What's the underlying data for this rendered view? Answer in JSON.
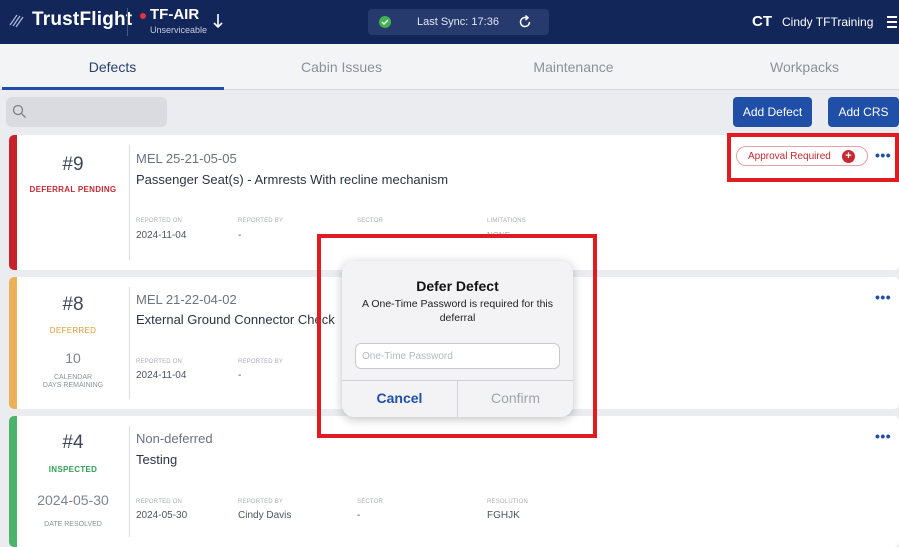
{
  "header": {
    "brand": "TrustFlight",
    "aircraft_reg": "TF-AIR",
    "aircraft_status": "Unserviceable",
    "sync_text": "Last Sync: 17:36",
    "avatar_initials": "CT",
    "user_name": "Cindy  TFTraining"
  },
  "tabs": [
    {
      "label": "Defects",
      "active": true
    },
    {
      "label": "Cabin Issues",
      "active": false
    },
    {
      "label": "Maintenance",
      "active": false
    },
    {
      "label": "Workpacks",
      "active": false
    }
  ],
  "toolbar": {
    "add_defect": "Add Defect",
    "add_crs": "Add CRS"
  },
  "defects": [
    {
      "number": "#9",
      "status": "DEFERRAL PENDING",
      "status_color": "#c62a33",
      "stripe_color": "#c8232c",
      "type": "MEL  25-21-05-05",
      "title": "Passenger Seat(s) - Armrests With recline mechanism",
      "reported_on_label": "REPORTED ON",
      "reported_on": "2024-11-04",
      "reported_by_label": "REPORTED BY",
      "reported_by": "-",
      "sector_label": "SECTOR",
      "limitations_label": "LIMITATIONS",
      "limitations": "NONE",
      "approval": "Approval Required"
    },
    {
      "number": "#8",
      "status": "DEFERRED",
      "status_color": "#e59a35",
      "stripe_color": "#ecb05a",
      "days_remaining": "10",
      "days_caption_1": "CALENDAR",
      "days_caption_2": "DAYS REMAINING",
      "type": "MEL  21-22-04-02",
      "title": "External Ground Connector Check",
      "reported_on_label": "REPORTED ON",
      "reported_on": "2024-11-04",
      "reported_by_label": "REPORTED BY",
      "reported_by": "-"
    },
    {
      "number": "#4",
      "status": "INSPECTED",
      "status_color": "#2f9e57",
      "stripe_color": "#4cb36b",
      "date_resolved": "2024-05-30",
      "date_resolved_label": "DATE RESOLVED",
      "type": "Non-deferred",
      "title": "Testing",
      "reported_on_label": "REPORTED ON",
      "reported_on": "2024-05-30",
      "reported_by_label": "REPORTED BY",
      "reported_by": "Cindy Davis",
      "sector_label": "SECTOR",
      "sector": "-",
      "resolution_label": "RESOLUTION",
      "resolution": "FGHJK"
    }
  ],
  "dialog": {
    "title": "Defer Defect",
    "message": "A One-Time Password is required for this deferral",
    "placeholder": "One-Time Password",
    "cancel": "Cancel",
    "confirm": "Confirm"
  },
  "colors": {
    "topbar": "#12265a",
    "accent": "#1f4fa7",
    "highlight": "#e21a22"
  }
}
